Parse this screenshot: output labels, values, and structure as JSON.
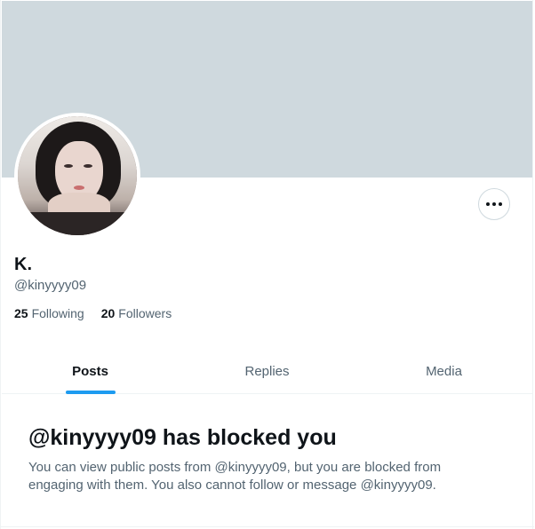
{
  "profile": {
    "display_name": "K.",
    "handle": "@kinyyyy09",
    "following_count": "25",
    "following_label": "Following",
    "followers_count": "20",
    "followers_label": "Followers"
  },
  "tabs": [
    {
      "label": "Posts",
      "active": true
    },
    {
      "label": "Replies",
      "active": false
    },
    {
      "label": "Media",
      "active": false
    }
  ],
  "blocked": {
    "title": "@kinyyyy09 has blocked you",
    "message": "You can view public posts from @kinyyyy09, but you are blocked from engaging with them. You also cannot follow or message @kinyyyy09."
  },
  "icons": {
    "more": "more-horizontal-icon"
  },
  "colors": {
    "banner": "#cfd9de",
    "accent": "#1d9bf0",
    "text_primary": "#0f1419",
    "text_secondary": "#536471"
  }
}
